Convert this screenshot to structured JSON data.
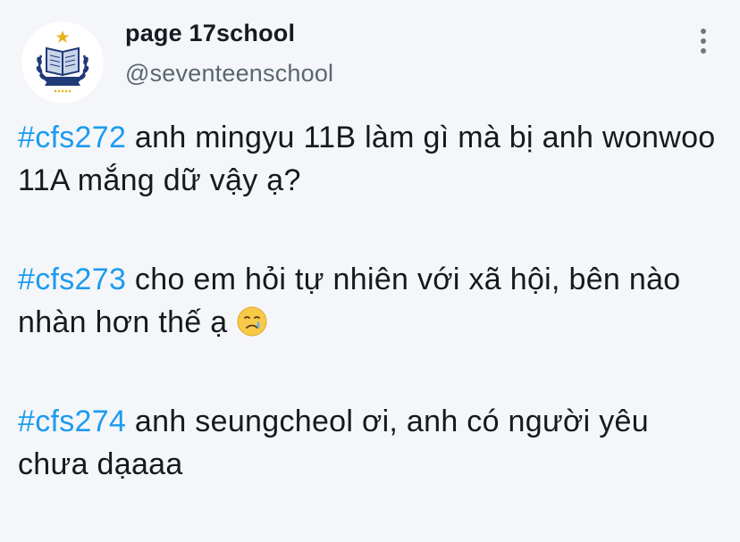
{
  "account": {
    "display_name": "page 17school",
    "handle": "@seventeenschool",
    "avatar_icon": "school-crest-logo"
  },
  "menu": {
    "icon": "more-vertical-icon"
  },
  "posts": [
    {
      "hashtag": "#cfs272",
      "text": " anh mingyu 11B làm gì mà bị anh wonwoo 11A mắng dữ vậy ạ?"
    },
    {
      "hashtag": "#cfs273",
      "text": " cho em hỏi tự nhiên với xã hội, bên nào nhàn hơn thế ạ ",
      "emoji": "crying-face-emoji"
    },
    {
      "hashtag": "#cfs274",
      "text": " anh seungcheol ơi, anh có người yêu chưa dạaaa"
    }
  ],
  "colors": {
    "hashtag": "#1d9bf0",
    "text": "#141a1f",
    "secondary": "#5b6770",
    "background": "#f4f6f9"
  }
}
